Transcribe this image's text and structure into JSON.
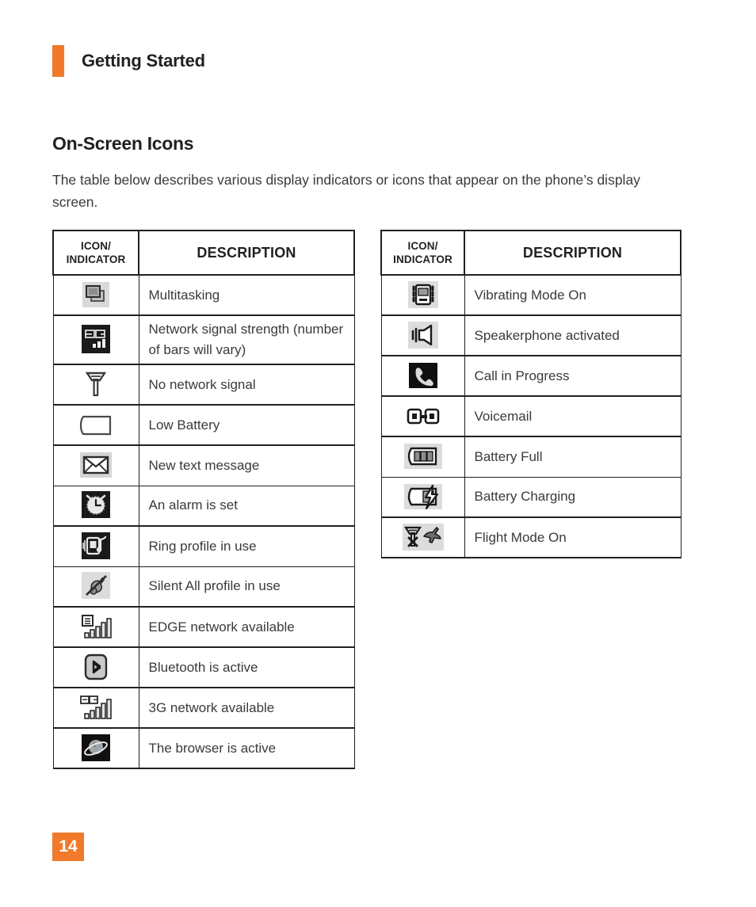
{
  "header": {
    "title": "Getting Started",
    "accent_color": "#F0792B"
  },
  "section": {
    "heading": "On-Screen Icons",
    "intro": "The table below describes various display indicators or icons that appear on the phone’s display screen."
  },
  "tables": {
    "columns": {
      "icon_header_line1": "ICON/",
      "icon_header_line2": "INDICATOR",
      "description_header": "DESCRIPTION"
    },
    "left": {
      "rows": [
        {
          "icon": "multitasking-icon",
          "description": "Multitasking"
        },
        {
          "icon": "3g-signal-strength-icon",
          "description": "Network signal strength (number of bars will vary)"
        },
        {
          "icon": "no-network-signal-icon",
          "description": "No network signal"
        },
        {
          "icon": "low-battery-icon",
          "description": "Low Battery"
        },
        {
          "icon": "new-text-message-icon",
          "description": "New text message"
        },
        {
          "icon": "alarm-clock-icon",
          "description": "An alarm is set"
        },
        {
          "icon": "ring-profile-icon",
          "description": "Ring profile in use"
        },
        {
          "icon": "silent-all-profile-icon",
          "description": "Silent All profile in use"
        },
        {
          "icon": "edge-network-icon",
          "description": "EDGE network available"
        },
        {
          "icon": "bluetooth-icon",
          "description": "Bluetooth is active"
        },
        {
          "icon": "3g-network-available-icon",
          "description": "3G network available"
        },
        {
          "icon": "browser-active-icon",
          "description": "The browser is active"
        }
      ]
    },
    "right": {
      "rows": [
        {
          "icon": "vibrating-mode-icon",
          "description": "Vibrating Mode On"
        },
        {
          "icon": "speakerphone-icon",
          "description": "Speakerphone activated"
        },
        {
          "icon": "call-in-progress-icon",
          "description": "Call in Progress"
        },
        {
          "icon": "voicemail-icon",
          "description": "Voicemail"
        },
        {
          "icon": "battery-full-icon",
          "description": "Battery Full"
        },
        {
          "icon": "battery-charging-icon",
          "description": "Battery Charging"
        },
        {
          "icon": "flight-mode-icon",
          "description": "Flight Mode On"
        }
      ]
    }
  },
  "footer": {
    "page_number": "14",
    "accent_color": "#F0792B"
  }
}
